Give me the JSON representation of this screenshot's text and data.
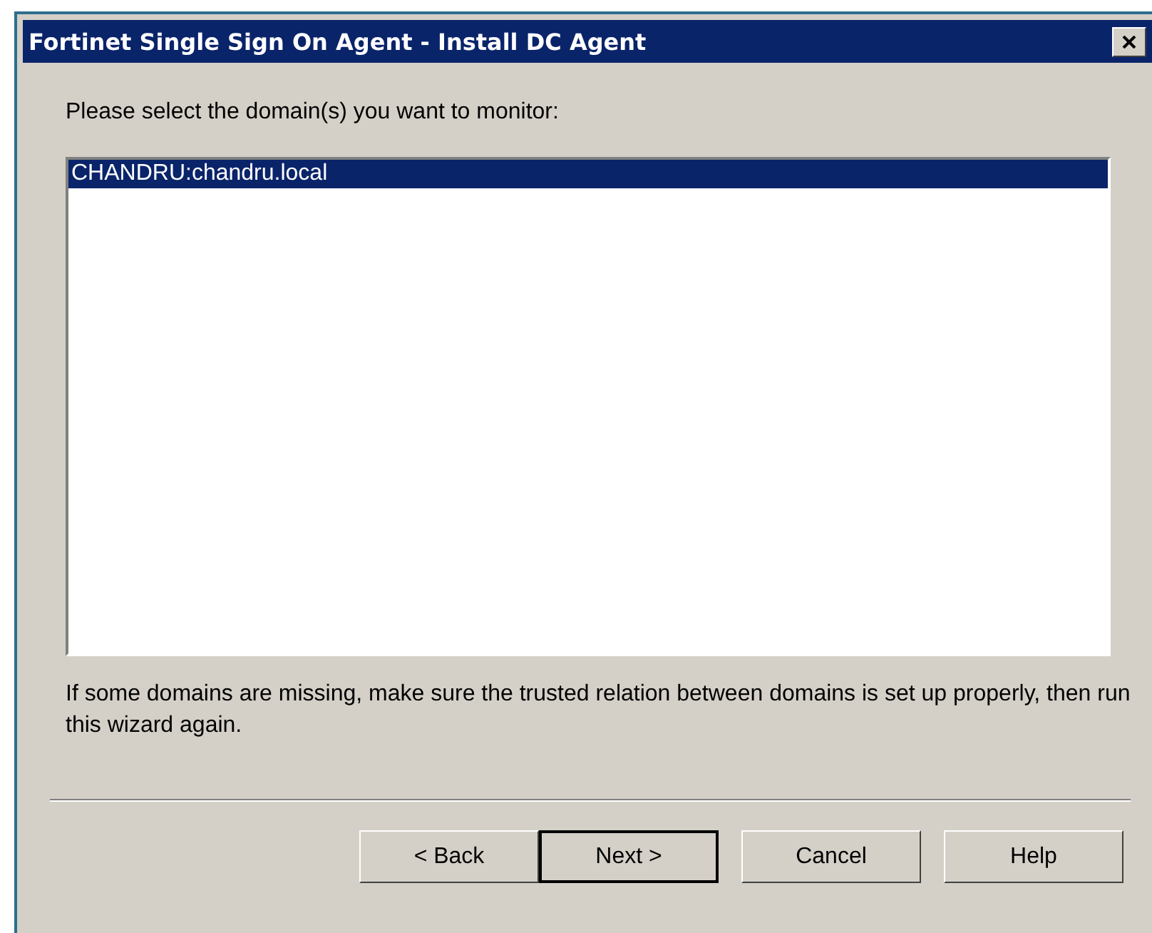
{
  "window": {
    "title": "Fortinet Single Sign On Agent - Install DC Agent"
  },
  "prompt": "Please select the domain(s) you want to monitor:",
  "domains": [
    {
      "label": "CHANDRU:chandru.local",
      "selected": true
    }
  ],
  "note": "If some domains are missing, make sure the trusted relation between domains is set up properly, then run this wizard again.",
  "buttons": [
    {
      "label": "< Back",
      "default": false
    },
    {
      "label": "Next >",
      "default": true
    },
    {
      "label": "Cancel",
      "default": false
    },
    {
      "label": "Help",
      "default": false
    }
  ]
}
